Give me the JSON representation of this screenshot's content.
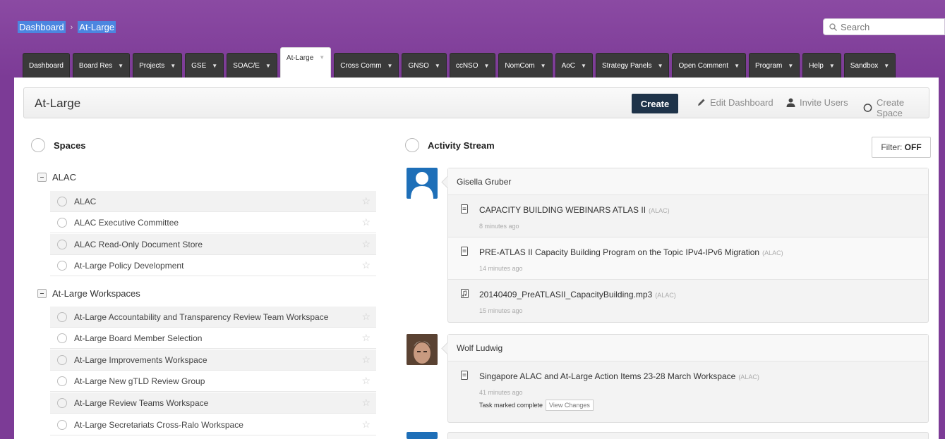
{
  "breadcrumb": [
    "Dashboard",
    "At-Large"
  ],
  "search": {
    "placeholder": "Search"
  },
  "nav_tabs": [
    {
      "label": "Dashboard",
      "dropdown": false
    },
    {
      "label": "Board Res",
      "dropdown": true
    },
    {
      "label": "Projects",
      "dropdown": true
    },
    {
      "label": "GSE",
      "dropdown": true
    },
    {
      "label": "SOAC/E",
      "dropdown": true
    },
    {
      "label": "At-Large",
      "dropdown": true,
      "active": true
    },
    {
      "label": "Cross Comm",
      "dropdown": true
    },
    {
      "label": "GNSO",
      "dropdown": true
    },
    {
      "label": "ccNSO",
      "dropdown": true
    },
    {
      "label": "NomCom",
      "dropdown": true
    },
    {
      "label": "AoC",
      "dropdown": true
    },
    {
      "label": "Strategy Panels",
      "dropdown": true
    },
    {
      "label": "Open Comment",
      "dropdown": true
    },
    {
      "label": "Program",
      "dropdown": true
    },
    {
      "label": "Help",
      "dropdown": true
    },
    {
      "label": "Sandbox",
      "dropdown": true
    }
  ],
  "titlebar": {
    "title": "At-Large",
    "create_label": "Create",
    "edit_dashboard": "Edit Dashboard",
    "invite_users": "Invite Users",
    "create_space": "Create Space"
  },
  "spaces": {
    "heading": "Spaces",
    "groups": [
      {
        "name": "ALAC",
        "items": [
          "ALAC",
          "ALAC Executive Committee",
          "ALAC Read-Only Document Store",
          "At-Large Policy Development"
        ]
      },
      {
        "name": "At-Large Workspaces",
        "items": [
          "At-Large Accountability and Transparency Review Team Workspace",
          "At-Large Board Member Selection",
          "At-Large Improvements Workspace",
          "At-Large New gTLD Review Group",
          "At-Large Review Teams Workspace",
          "At-Large Secretariats Cross-Ralo Workspace"
        ]
      }
    ]
  },
  "activity": {
    "heading": "Activity Stream",
    "filter_label": "Filter:",
    "filter_value": "OFF",
    "entries": [
      {
        "user": "Gisella Gruber",
        "items": [
          {
            "title": "CAPACITY BUILDING WEBINARS ATLAS II",
            "space": "(ALAC)",
            "time": "8 minutes ago",
            "icon": "document-icon"
          },
          {
            "title": "PRE-ATLAS II Capacity Building Program on the Topic IPv4-IPv6 Migration",
            "space": "(ALAC)",
            "time": "14 minutes ago",
            "icon": "document-icon"
          },
          {
            "title": "20140409_PreATLASII_CapacityBuilding.mp3",
            "space": "(ALAC)",
            "time": "15 minutes ago",
            "icon": "audio-file-icon"
          }
        ]
      },
      {
        "user": "Wolf Ludwig",
        "items": [
          {
            "title": "Singapore ALAC and At-Large Action Items 23-28 March Workspace",
            "space": "(ALAC)",
            "time": "41 minutes ago",
            "icon": "document-icon",
            "task": "Task marked complete",
            "view_changes": "View Changes"
          }
        ]
      }
    ]
  }
}
